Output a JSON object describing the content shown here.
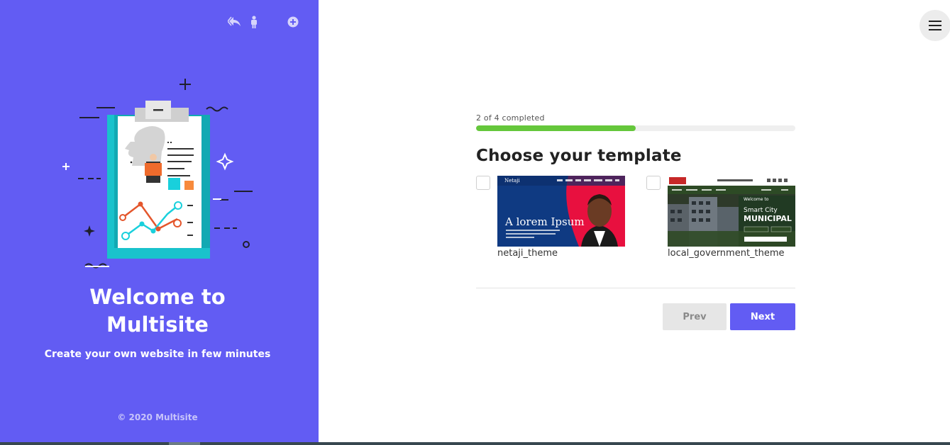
{
  "left_panel": {
    "welcome_line1": "Welcome to",
    "welcome_line2": "Multisite",
    "tagline": "Create your own website in few minutes",
    "copyright": "© 2020 Multisite",
    "icons": [
      "reply-icon",
      "person-icon",
      "add-circle-icon"
    ]
  },
  "progress": {
    "label": "2 of 4 completed",
    "completed": 2,
    "total": 4
  },
  "heading": "Choose your template",
  "templates": [
    {
      "name": "netaji_theme",
      "checked": false,
      "thumb_logo": "Netaji",
      "thumb_headline": "A lorem Ipsum"
    },
    {
      "name": "local_government_theme",
      "checked": false,
      "thumb_welcome": "Welcome to",
      "thumb_sub": "Smart City",
      "thumb_title": "MUNICIPAL"
    }
  ],
  "buttons": {
    "prev": "Prev",
    "next": "Next"
  },
  "colors": {
    "brand": "#625cf3",
    "progress": "#65c73b"
  }
}
